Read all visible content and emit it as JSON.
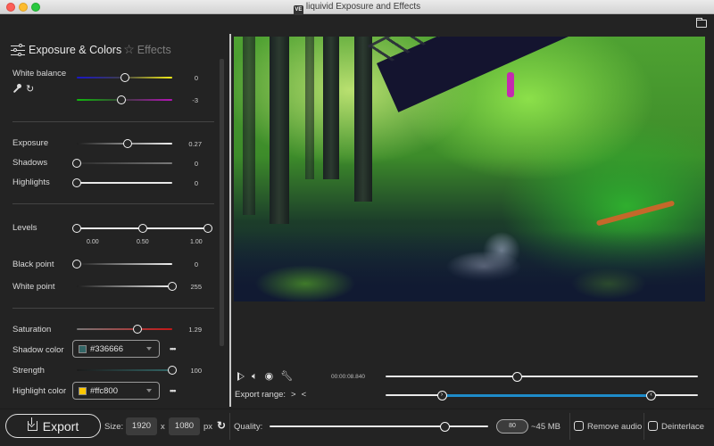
{
  "window": {
    "title": "liquivid Exposure and Effects",
    "app_badge": "VE"
  },
  "toolbar": {
    "open_folder_icon": "folder-icon"
  },
  "tabs": [
    {
      "label": "Exposure & Colors",
      "icon": "sliders-icon",
      "active": true
    },
    {
      "label": "Effects",
      "icon": "star-icon",
      "active": false
    }
  ],
  "white_balance": {
    "label": "White balance",
    "temperature": {
      "value": "0",
      "fraction": 0.5
    },
    "tint": {
      "value": "-3",
      "fraction": 0.47
    },
    "tools": [
      "eyedropper-icon",
      "reset-icon"
    ]
  },
  "exposure": {
    "label": "Exposure",
    "value": "0.27",
    "fraction": 0.53
  },
  "shadows": {
    "label": "Shadows",
    "value": "0",
    "fraction": 0.0
  },
  "highlights": {
    "label": "Highlights",
    "value": "0",
    "fraction": 0.0
  },
  "levels": {
    "label": "Levels",
    "ticks": [
      "0.00",
      "0.50",
      "1.00"
    ],
    "handles": [
      0.0,
      0.5,
      1.0
    ]
  },
  "black_point": {
    "label": "Black point",
    "value": "0",
    "fraction": 0.0
  },
  "white_point": {
    "label": "White point",
    "value": "255",
    "fraction": 1.0
  },
  "saturation": {
    "label": "Saturation",
    "value": "1.29",
    "fraction": 0.64
  },
  "shadow_color": {
    "label": "Shadow color",
    "hex": "#336666",
    "more": "•••"
  },
  "strength": {
    "label": "Strength",
    "value": "100",
    "fraction": 1.0
  },
  "highlight_color": {
    "label": "Highlight color",
    "hex": "#ffc800",
    "more": "•••"
  },
  "playback": {
    "timecode": "00:00:08.840",
    "position_fraction": 0.42,
    "controls": [
      "play-icon",
      "volume-icon",
      "eye-icon",
      "wrench-icon"
    ]
  },
  "export_range": {
    "label": "Export range:",
    "set_in": ">",
    "set_out": "<",
    "start_fraction": 0.18,
    "end_fraction": 0.85,
    "accent": "#1e8bc9"
  },
  "bottom": {
    "export_label": "Export",
    "size_label": "Size:",
    "width": "1920",
    "x_label": "x",
    "height": "1080",
    "unit": "px",
    "quality_label": "Quality:",
    "quality_value": "80",
    "quality_fraction": 0.8,
    "estimated_size": "~45 MB",
    "remove_audio_label": "Remove audio",
    "remove_audio_checked": false,
    "deinterlace_label": "Deinterlace",
    "deinterlace_checked": false
  }
}
